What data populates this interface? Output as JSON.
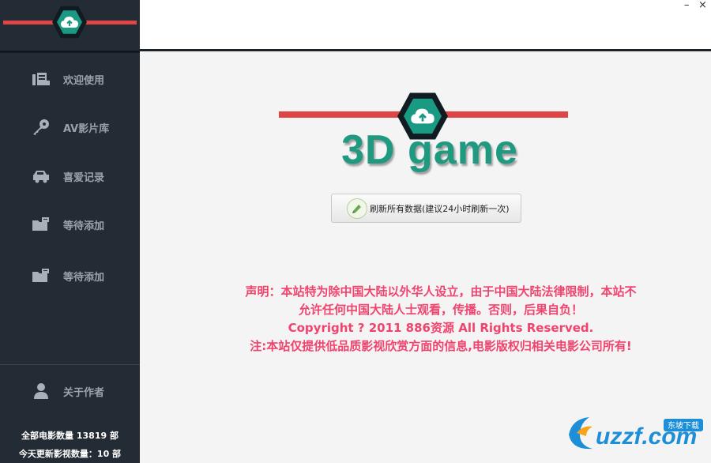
{
  "window": {
    "minimize_glyph": "–",
    "close_glyph": "×"
  },
  "sidebar": {
    "items": [
      {
        "label": "欢迎使用",
        "icon": "welcome-icon"
      },
      {
        "label": "AV影片库",
        "icon": "key-icon"
      },
      {
        "label": "喜爱记录",
        "icon": "car-icon"
      },
      {
        "label": "等待添加",
        "icon": "folder-icon"
      },
      {
        "label": "等待添加",
        "icon": "folder-icon"
      }
    ],
    "about": {
      "label": "关于作者",
      "icon": "user-icon"
    },
    "stats": {
      "total": "全部电影数量 13819 部",
      "today": "今天更新影视数量：10 部"
    }
  },
  "main": {
    "title": "3D game",
    "refresh_button": "刷新所有数据(建议24小时刷新一次)",
    "notice": [
      "声明：本站特为除中国大陆以外华人设立，由于中国大陆法律限制，本站不",
      "允许任何中国大陆人士观看，传播。否则，后果自负！",
      "Copyright ? 2011 886资源  All Rights Reserved.",
      "注:本站仅提供低品质影视欣赏方面的信息,电影版权归相关电影公司所有!"
    ]
  },
  "watermark": {
    "text": "uzzf.com",
    "badge": "东坡下载"
  },
  "colors": {
    "sidebar_bg": "#232b34",
    "accent_red": "#e04545",
    "brand_teal": "#1f9a80",
    "notice_pink": "#f0446e"
  }
}
